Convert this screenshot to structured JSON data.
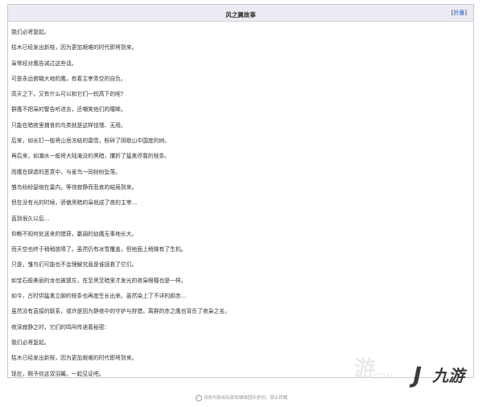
{
  "header": {
    "title": "风之翼故事",
    "collapse_open": "[",
    "collapse_label": "折叠",
    "collapse_close": "]"
  },
  "story": {
    "lines": [
      "我们必将复起。",
      "枯木已经发出新枝，因为更加艰难的时代即将到来。",
      "枭常经对鹰告诫过这些话。",
      "可是永远俯瞰大地的鹰，有着主宰青空的自负。",
      "高天之下，又有什么可以和它们一较高下的呢?",
      "群鹰不把枭的警告听进去，还嘲笑他们的瞳眸。",
      "只能在暗夜里捕食的鸟类就是这样怯懦、无用。",
      "后来，如长钉一般将山岳冻结的霜雪，粉碎了阴歇山中国度的树。",
      "再后来，如潮水一般将大陆淹没的黑暗，攫折了猛禽停靠的枝条。",
      "而鹰在肆虐的恶意中，与雀鸟一同纷纷坠落。",
      "雏鸟纷纷瑟缩在巢内，等待寂静而悲哀的结局到来。",
      "但在没有光的时候，骄傲黑暗的枭就成了夜的主宰…",
      "直到很久以后…",
      "仰赖不知何处送来的猎获，羸弱的幼鹰无事地长大。",
      "而天空也终于稍稍放晴了。虽然仍有冰雪覆盖，但地面上稍微有了生机。",
      "只是，雏鸟们可能也不会理解究竟是谁拯救了它们。",
      "如宝石般美丽的龙也被遗忘，在至黑至暗里才发光的夜枭眼瞳也是一样。",
      "如今，古时供猛禽立脚的枝条也再度生长出来。虽然染上了不详的颜赤…",
      "虽然没有直接的联系，或许是因为静夜中的守护与狩猎，离群的赤之鹰也背负了夜枭之名。",
      "夜深寂静之时，它们的鸣叫传递着秘密:",
      "我们必将复起。",
      "枯木已经发出新枝，因为更加艰难的时代即将到来。",
      "现在，赐予你这双羽翼。一起见证吧。"
    ]
  },
  "watermark": {
    "text": "游",
    "sub": "YOU"
  },
  "brand": {
    "glyph": "J",
    "name": "九游"
  },
  "footer": {
    "icon": "i",
    "text": "词条内容由玩家和编辑团队原创，禁止转载"
  }
}
